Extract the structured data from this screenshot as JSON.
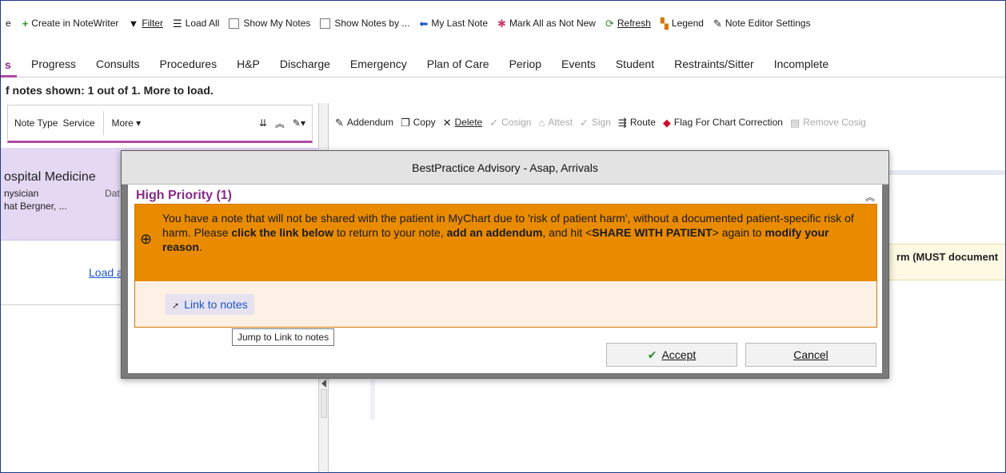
{
  "toolbar": {
    "partial_left": "e",
    "items": [
      {
        "label": "Create in NoteWriter",
        "icon": "plus-icon"
      },
      {
        "label": "Filter",
        "icon": "filter-icon"
      },
      {
        "label": "Load All",
        "icon": "list-icon"
      },
      {
        "label": "Show My Notes",
        "icon": "checkbox"
      },
      {
        "label": "Show Notes by ...",
        "icon": "checkbox"
      },
      {
        "label": "My Last Note",
        "icon": "back-arrow-icon"
      },
      {
        "label": "Mark All as Not New",
        "icon": "sparkle-icon"
      },
      {
        "label": "Refresh",
        "icon": "refresh-icon"
      },
      {
        "label": "Legend",
        "icon": "legend-icon"
      },
      {
        "label": "Note Editor Settings",
        "icon": "wrench-icon"
      }
    ]
  },
  "tabs": {
    "active_fragment": "s",
    "items": [
      "Progress",
      "Consults",
      "Procedures",
      "H&P",
      "Discharge",
      "Emergency",
      "Plan of Care",
      "Periop",
      "Events",
      "Student",
      "Restraints/Sitter",
      "Incomplete"
    ]
  },
  "summary_text": "f notes shown: 1 out of 1.  More to load.",
  "left_panel": {
    "header": {
      "note_type": "Note Type",
      "service": "Service",
      "more": "More ▾"
    },
    "note": {
      "title": "ospital Medicine",
      "role": "nysician",
      "date_label": "Dat",
      "author": "hat Bergner, ..."
    },
    "load_link": "Load a"
  },
  "right_panel": {
    "toolbar": [
      {
        "label": "Addendum",
        "icon": "pencil-icon",
        "enabled": true
      },
      {
        "label": "Copy",
        "icon": "copy-icon",
        "enabled": true
      },
      {
        "label": "Delete",
        "icon": "delete-x-icon",
        "enabled": true
      },
      {
        "label": "Cosign",
        "icon": "check-icon",
        "enabled": false
      },
      {
        "label": "Attest",
        "icon": "attest-icon",
        "enabled": false
      },
      {
        "label": "Sign",
        "icon": "check-icon",
        "enabled": false
      },
      {
        "label": "Route",
        "icon": "route-icon",
        "enabled": true
      },
      {
        "label": "Flag For Chart Correction",
        "icon": "flag-diamond-icon",
        "enabled": true
      },
      {
        "label": "Remove Cosig",
        "icon": "remove-icon",
        "enabled": false
      }
    ],
    "banner_text": "rm (MUST document"
  },
  "modal": {
    "title": "BestPractice Advisory - Asap, Arrivals",
    "priority_heading": "High Priority (1)",
    "message": {
      "part1": "You have a note that will not be shared with the patient in MyChart due to 'risk of patient harm', without a documented patient-specific risk of harm. Please ",
      "bold1": "click the link below",
      "part2": " to return to your note, ",
      "bold2": "add an addendum",
      "part3": ", and hit <",
      "bold3": "SHARE WITH PATIENT",
      "part4": "> again to ",
      "bold4": "modify your reason",
      "part5": "."
    },
    "link_label": "Link to notes",
    "tooltip": "Jump to Link to notes",
    "accept_label": "Accept",
    "cancel_label": "Cancel"
  }
}
